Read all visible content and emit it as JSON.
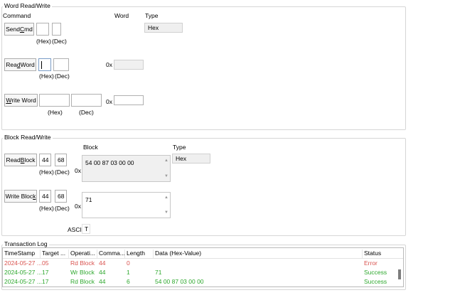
{
  "word": {
    "title": "Word Read/Write",
    "command_header": "Command",
    "word_header": "Word",
    "type_header": "Type",
    "type_value": "Hex",
    "send_cmd": {
      "label_pre": "Send ",
      "label_u": "C",
      "label_post": "md",
      "hex": "",
      "dec": ""
    },
    "read_word": {
      "label_pre": "Rea",
      "label_u": "d",
      "label_post": " Word",
      "hex": "",
      "dec": "",
      "prefix": "0x",
      "value": ""
    },
    "write_word": {
      "label_pre": "",
      "label_u": "W",
      "label_post": "rite Word",
      "hex": "",
      "dec": "",
      "prefix": "0x",
      "value": ""
    },
    "hex_label": "(Hex)",
    "dec_label": "(Dec)"
  },
  "block": {
    "title": "Block Read/Write",
    "block_header": "Block",
    "type_header": "Type",
    "type_value": "Hex",
    "read_block": {
      "label_pre": "Read ",
      "label_u": "B",
      "label_post": "lock",
      "hex": "44",
      "dec": "68",
      "prefix": "0x",
      "value": "54 00 87 03 00 00"
    },
    "write_block": {
      "label_pre": "Write Bloc",
      "label_u": "k",
      "label_post": "",
      "hex": "44",
      "dec": "68",
      "prefix": "0x",
      "value": "71"
    },
    "hex_label": "(Hex)",
    "dec_label": "(Dec)",
    "ascii_label": "ASCII",
    "ascii_value": "T"
  },
  "log": {
    "title": "Transaction Log",
    "columns": [
      "TimeStamp",
      "Target ...",
      "Operati...",
      "Comma...",
      "Length",
      "Data (Hex-Value)",
      "Status"
    ],
    "rows": [
      {
        "timestamp": "2024-05-27 ...",
        "target": "05",
        "operation": "Rd Block",
        "command": "44",
        "length": "0",
        "data": "",
        "status": "Error",
        "status_color": "#d9534f"
      },
      {
        "timestamp": "2024-05-27 ...",
        "target": "17",
        "operation": "Wr Block",
        "command": "44",
        "length": "1",
        "data": "71",
        "status": "Success",
        "status_color": "#2ea82e"
      },
      {
        "timestamp": "2024-05-27 ...",
        "target": "17",
        "operation": "Rd Block",
        "command": "44",
        "length": "6",
        "data": "54 00 87 03 00 00",
        "status": "Success",
        "status_color": "#2ea82e"
      }
    ]
  }
}
